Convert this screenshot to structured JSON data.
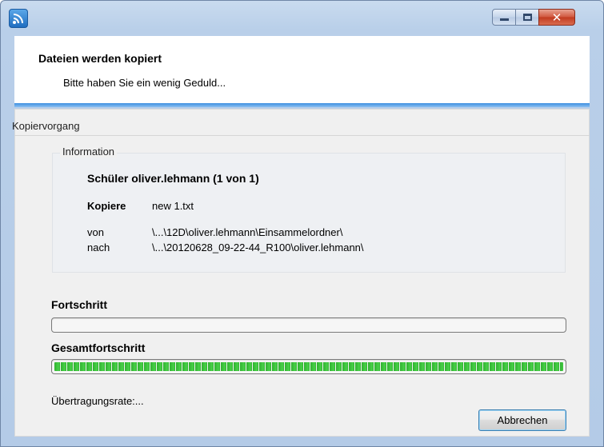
{
  "window": {
    "icon": "wireless-app-icon",
    "controls": {
      "minimize": "minimize-icon",
      "maximize": "maximize-icon",
      "close": "close-icon",
      "close_glyph": "✕"
    }
  },
  "header": {
    "title": "Dateien werden kopiert",
    "subtitle": "Bitte haben Sie ein wenig Geduld..."
  },
  "group": {
    "caption": "Kopiervorgang"
  },
  "information": {
    "caption": "Information",
    "student": "Schüler oliver.lehmann (1 von 1)",
    "copy_label": "Kopiere",
    "copy_value": "new  1.txt",
    "from_label": "von",
    "from_value": "\\...\\12D\\oliver.lehmann\\Einsammelordner\\",
    "to_label": "nach",
    "to_value": "\\...\\20120628_09-22-44_R100\\oliver.lehmann\\"
  },
  "progress": {
    "label": "Fortschritt",
    "fraction": 0.0
  },
  "total_progress": {
    "label": "Gesamtfortschritt",
    "fraction": 1.0
  },
  "transfer_rate": {
    "label": "Übertragungsrate:..."
  },
  "buttons": {
    "cancel": "Abbrechen"
  },
  "colors": {
    "progress_green": "#3cc13c",
    "header_accent": "#3d8ee0",
    "titlebar": "#c9dbef"
  }
}
